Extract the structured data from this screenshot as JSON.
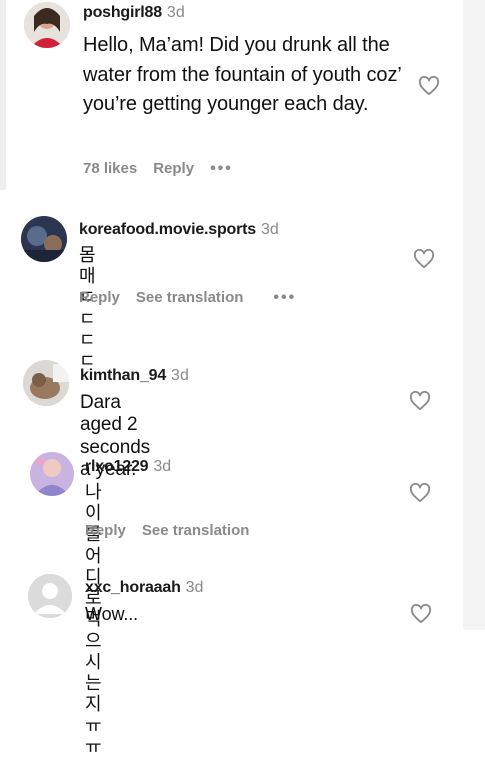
{
  "colors": {
    "text": "#111111",
    "muted": "#8a8a8a",
    "background": "#ffffff"
  },
  "comments": [
    {
      "username": "poshgirl88",
      "time": "3d",
      "text": "Hello, Ma’am! Did you drunk all the water from the fountain of youth coz’ you’re getting younger each day.",
      "likes": "78 likes",
      "reply": "Reply",
      "more": "•••",
      "icon": "heart-outline-icon"
    },
    {
      "username": "koreafood.movie.sports",
      "time": "3d",
      "text": "몸매 ㄷㄷㄷㄷ",
      "reply": "Reply",
      "translate": "See translation",
      "more": "•••",
      "icon": "heart-outline-icon"
    },
    {
      "username": "kimthan_94",
      "time": "3d",
      "text": "Dara aged 2 seconds a year.",
      "icon": "heart-outline-icon"
    },
    {
      "username": "rlxo1229",
      "time": "3d",
      "text": "나이를 어디로 먹으시는지 ㅠㅠ",
      "reply": "Reply",
      "translate": "See translation",
      "icon": "heart-outline-icon"
    },
    {
      "username": "xxc_horaaah",
      "time": "3d",
      "text": "Wow...",
      "icon": "heart-outline-icon"
    }
  ]
}
